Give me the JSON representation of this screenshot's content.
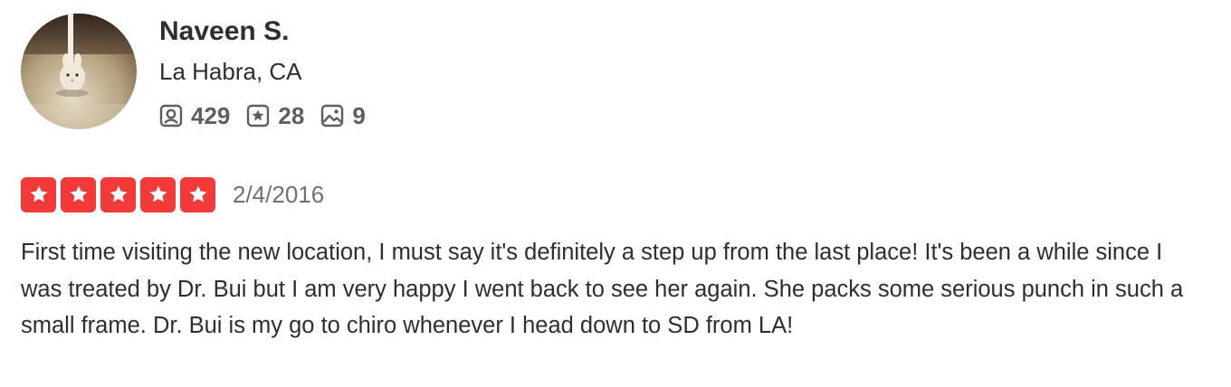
{
  "user": {
    "name": "Naveen S.",
    "location": "La Habra, CA",
    "stats": {
      "friends": "429",
      "reviews": "28",
      "photos": "9"
    }
  },
  "review": {
    "rating": 5,
    "rating_max": 5,
    "date": "2/4/2016",
    "text": "First time visiting the new location, I must say it's definitely a step up from the last place! It's been a while since I was treated by Dr. Bui but I am very happy I went back to see her again. She packs some serious punch in such a small frame. Dr. Bui is my go to chiro whenever I head down to SD from LA!"
  },
  "icons": {
    "friends": "friends-icon",
    "reviews": "review-star-icon",
    "photos": "photo-icon",
    "star": "star-icon"
  },
  "colors": {
    "star_fill": "#f43939",
    "text": "#2d2e2f",
    "muted": "#6e7072",
    "stat_text": "#5e5e5e"
  }
}
